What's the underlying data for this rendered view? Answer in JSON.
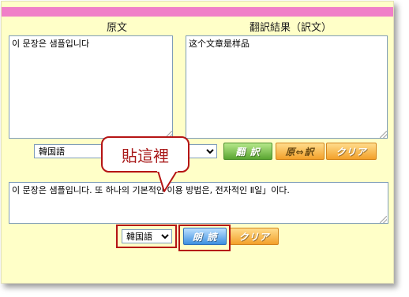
{
  "headers": {
    "source": "原文",
    "result": "翻訳結果（訳文）"
  },
  "source_text": "이 문장은 샘플입니다",
  "result_text": "这个文章是样品",
  "top_controls": {
    "language": "韓国語",
    "translate_button": "翻 訳",
    "swap_button": "原⇔訳",
    "clear_button": "クリア"
  },
  "callout_text": "貼這裡",
  "reading_text": "이 문장은 샘플입니다. 또 하나의 기본적인 이용 방법은, 전자적인 Ⅱ일」이다.",
  "bottom_controls": {
    "language": "韓国語",
    "read_button": "朗 読",
    "clear_button": "クリア"
  },
  "colors": {
    "page_bg": "#ffffc8",
    "pink_bar": "#f080c8",
    "highlight_red": "#b51414"
  }
}
